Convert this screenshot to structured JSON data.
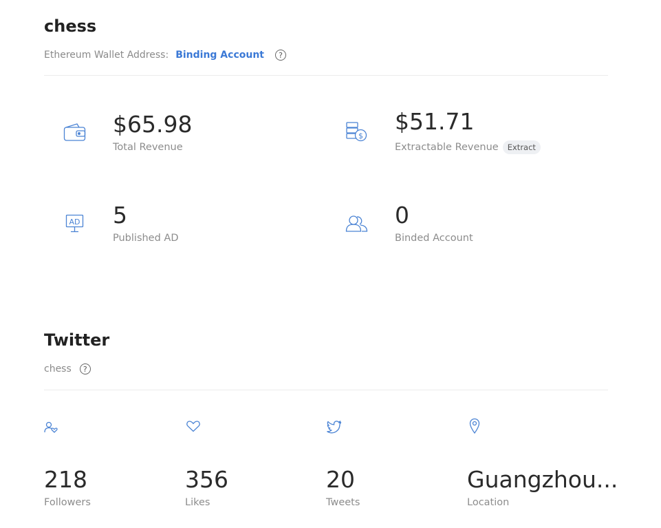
{
  "account": {
    "title": "chess",
    "wallet_label": "Ethereum Wallet Address:",
    "binding_link": "Binding Account",
    "help_glyph": "?"
  },
  "stats": {
    "total_revenue": {
      "value": "$65.98",
      "label": "Total Revenue",
      "icon": "wallet-icon"
    },
    "extractable_revenue": {
      "value": "$51.71",
      "label": "Extractable Revenue",
      "action": "Extract",
      "icon": "coins-dollar-icon"
    },
    "published_ad": {
      "value": "5",
      "label": "Published AD",
      "icon": "ad-monitor-icon",
      "icon_text": "AD"
    },
    "binded_account": {
      "value": "0",
      "label": "Binded Account",
      "icon": "users-icon"
    }
  },
  "twitter": {
    "title": "Twitter",
    "handle": "chess",
    "help_glyph": "?",
    "metrics": [
      {
        "value": "218",
        "label": "Followers",
        "icon": "follower-heart-icon"
      },
      {
        "value": "356",
        "label": "Likes",
        "icon": "heart-icon"
      },
      {
        "value": "20",
        "label": "Tweets",
        "icon": "twitter-bird-icon"
      },
      {
        "value": "Guangzhou...",
        "label": "Location",
        "icon": "location-pin-icon"
      }
    ]
  },
  "colors": {
    "accent": "#3b79d6",
    "icon": "#4a83d4",
    "muted": "#8c8c8c",
    "badge_bg": "#eef0f3"
  }
}
